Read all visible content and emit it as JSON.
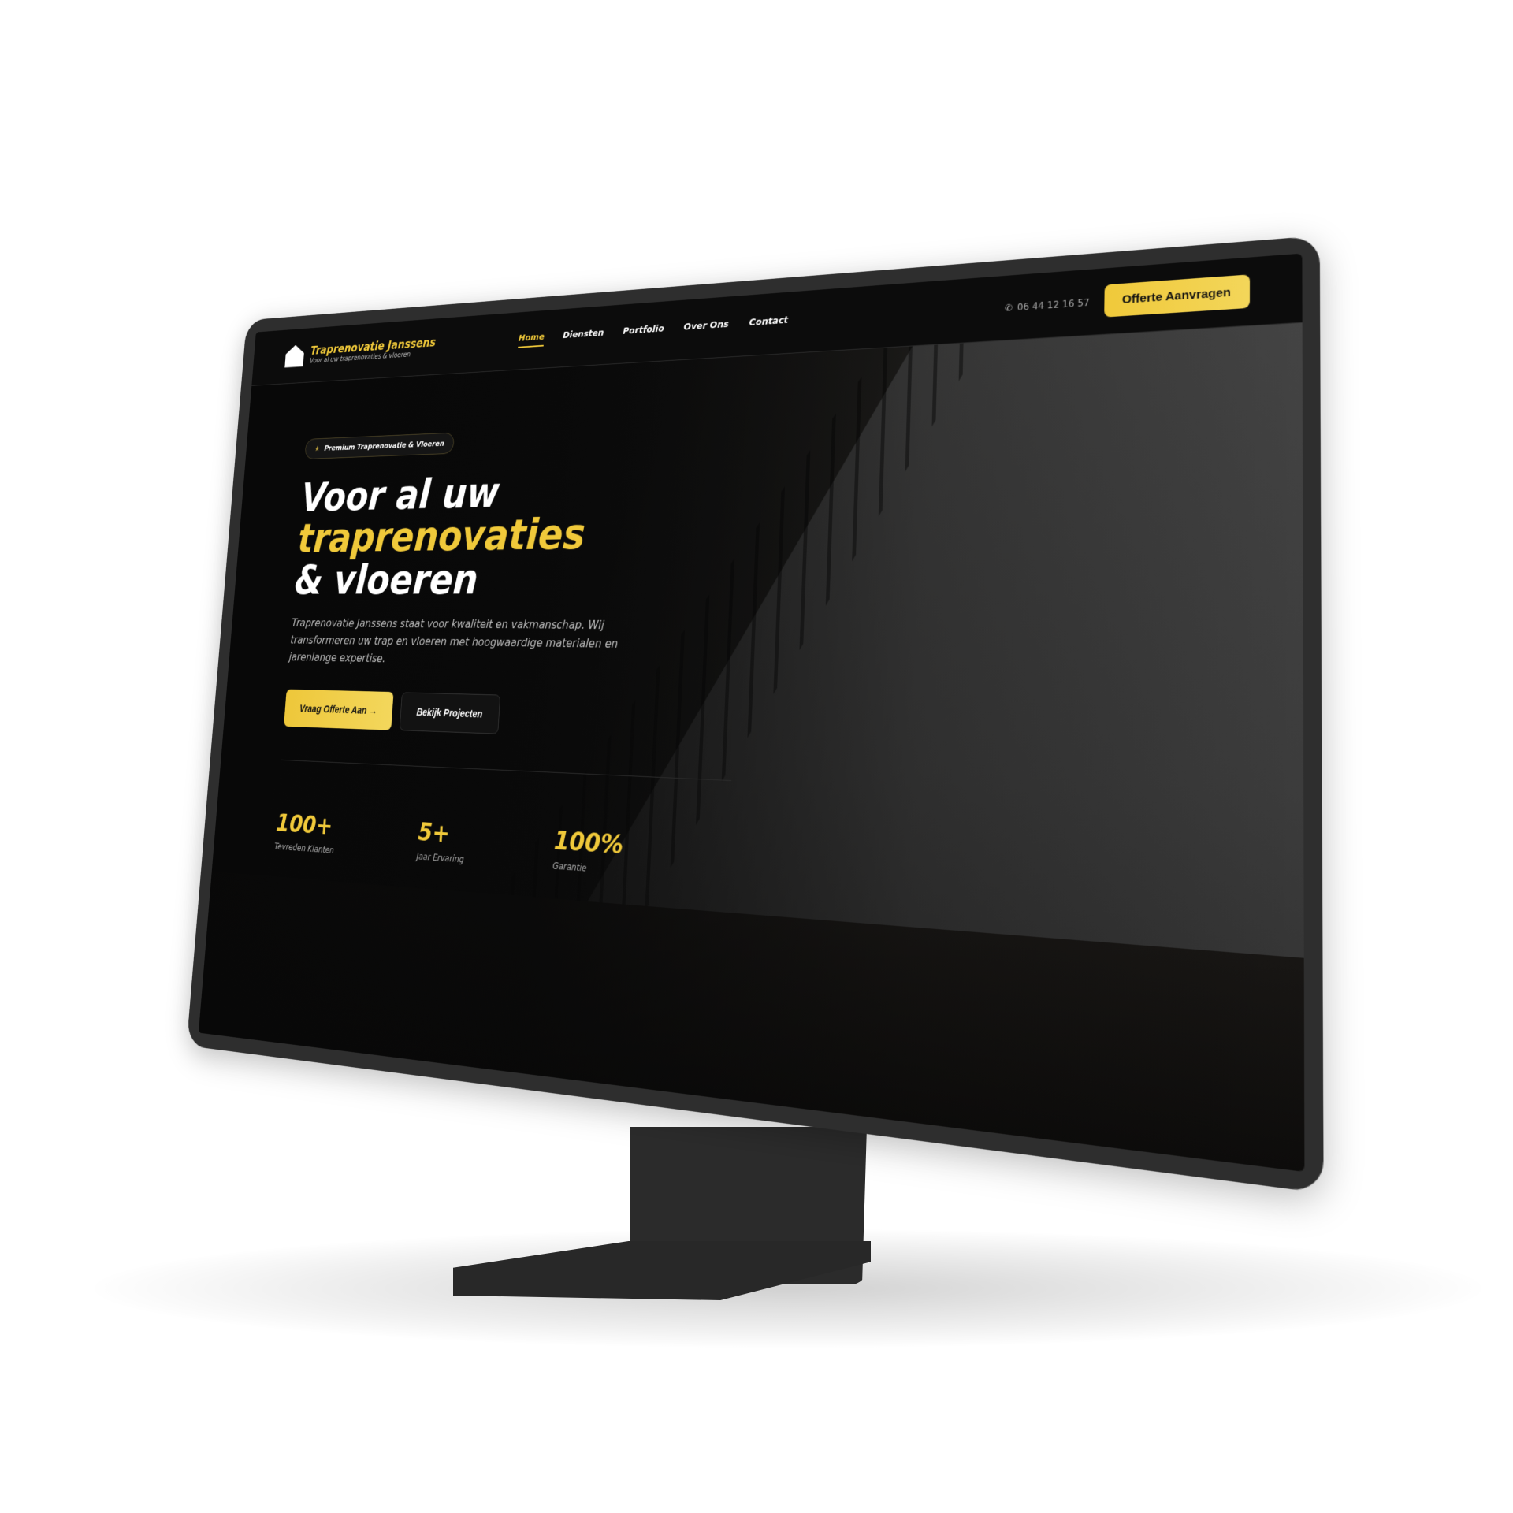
{
  "colors": {
    "accent": "#f0c93a",
    "background": "#0b0b0b",
    "bezel": "#2e2e2e"
  },
  "nav": {
    "brand_name": "Traprenovatie Janssens",
    "brand_tagline": "Voor al uw traprenovaties & vloeren",
    "logo_icon": "house-icon",
    "items": [
      {
        "label": "Home",
        "active": true
      },
      {
        "label": "Diensten"
      },
      {
        "label": "Portfolio"
      },
      {
        "label": "Over Ons"
      },
      {
        "label": "Contact"
      }
    ],
    "phone_icon": "phone-icon",
    "phone": "06 44 12 16 57",
    "cta": "Offerte Aanvragen"
  },
  "hero": {
    "badge_icon": "star-icon",
    "badge": "Premium Traprenovatie & Vloeren",
    "title_line1": "Voor al uw",
    "title_highlight": "traprenovaties",
    "title_line3": "& vloeren",
    "description": "Traprenovatie Janssens staat voor kwaliteit en vakmanschap. Wij transformeren uw trap en vloeren met hoogwaardige materialen en jarenlange expertise.",
    "primary_button": "Vraag Offerte Aan",
    "primary_button_icon": "arrow-right-icon",
    "secondary_button": "Bekijk Projecten"
  },
  "stats": [
    {
      "value": "100+",
      "label": "Tevreden Klanten"
    },
    {
      "value": "5+",
      "label": "Jaar Ervaring"
    },
    {
      "value": "100%",
      "label": "Garantie"
    }
  ]
}
